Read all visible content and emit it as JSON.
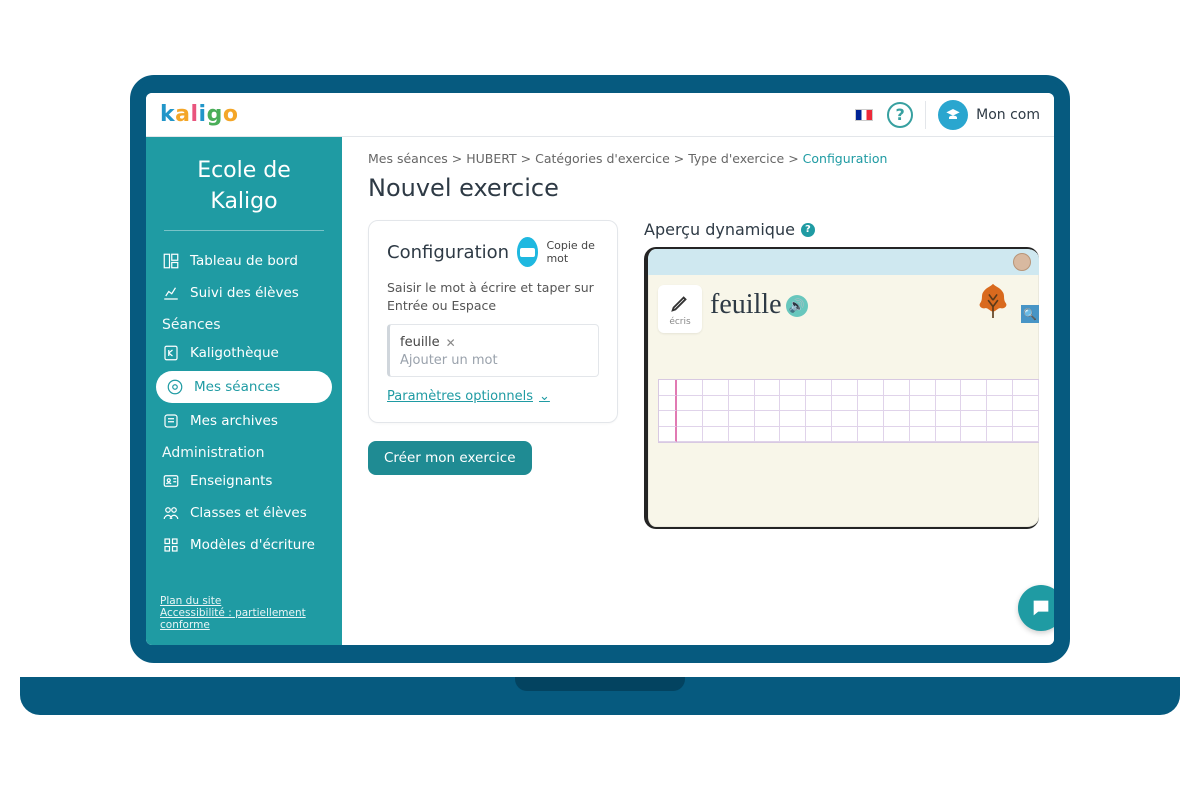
{
  "header": {
    "logo_text": "kaligo",
    "account_label": "Mon com"
  },
  "sidebar": {
    "school_line1": "Ecole de",
    "school_line2": "Kaligo",
    "items_top": [
      {
        "label": "Tableau de bord"
      },
      {
        "label": "Suivi des élèves"
      }
    ],
    "section_sessions": "Séances",
    "items_sessions": [
      {
        "label": "Kaligothèque"
      },
      {
        "label": "Mes séances"
      },
      {
        "label": "Mes archives"
      }
    ],
    "section_admin": "Administration",
    "items_admin": [
      {
        "label": "Enseignants"
      },
      {
        "label": "Classes et élèves"
      },
      {
        "label": "Modèles d'écriture"
      }
    ],
    "footer_sitemap": "Plan du site",
    "footer_a11y": "Accessibilité : partiellement conforme"
  },
  "main": {
    "breadcrumb": {
      "parts": [
        "Mes séances",
        "HUBERT",
        "Catégories d'exercice",
        "Type d'exercice"
      ],
      "last": "Configuration",
      "sep": " > "
    },
    "page_title": "Nouvel exercice",
    "config": {
      "title": "Configuration",
      "badge_label": "Copie de mot",
      "instruction": "Saisir le mot à écrire et taper sur Entrée ou Espace",
      "tag": "feuille",
      "placeholder": "Ajouter un mot",
      "optional_params": "Paramètres optionnels",
      "create_button": "Créer mon exercice"
    },
    "preview": {
      "title": "Aperçu dynamique",
      "pen_caption": "écris",
      "word": "feuille"
    }
  }
}
